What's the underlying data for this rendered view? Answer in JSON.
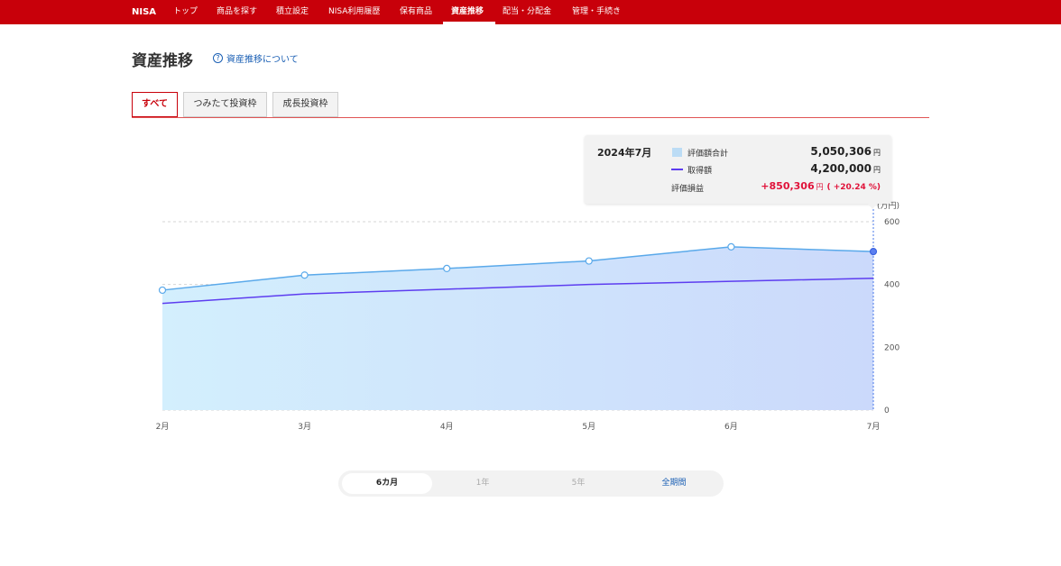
{
  "nav": {
    "brand": "NISA",
    "items": [
      {
        "label": "トップ"
      },
      {
        "label": "商品を探す"
      },
      {
        "label": "積立設定"
      },
      {
        "label": "NISA利用履歴"
      },
      {
        "label": "保有商品"
      },
      {
        "label": "資産推移",
        "active": true
      },
      {
        "label": "配当・分配金"
      },
      {
        "label": "管理・手続き"
      }
    ]
  },
  "page": {
    "title": "資産推移",
    "help_link": "資産推移について"
  },
  "tabs": [
    {
      "label": "すべて",
      "active": true
    },
    {
      "label": "つみたて投資枠"
    },
    {
      "label": "成長投資枠"
    }
  ],
  "tooltip": {
    "date": "2024年7月",
    "valuation_label": "評価額合計",
    "valuation_value": "5,050,306",
    "cost_label": "取得額",
    "cost_value": "4,200,000",
    "gain_label": "評価損益",
    "gain_value": "+850,306",
    "gain_pct": "( +20.24 %)",
    "unit": "円"
  },
  "colors": {
    "brand": "#c8000a",
    "valuation_line": "#5aa9ea",
    "cost_line": "#5d3df0",
    "gain": "#e0133a"
  },
  "chart_data": {
    "type": "area",
    "y_unit_label": "(万円)",
    "categories": [
      "2月",
      "3月",
      "4月",
      "5月",
      "6月",
      "7月"
    ],
    "ylim": [
      0,
      600
    ],
    "yticks": [
      "0",
      "200",
      "400",
      "600"
    ],
    "series": [
      {
        "name": "評価額合計",
        "kind": "area",
        "values": [
          382,
          430,
          451,
          475,
          520,
          505
        ]
      },
      {
        "name": "取得額",
        "kind": "line",
        "values": [
          340,
          370,
          385,
          400,
          410,
          420
        ]
      }
    ],
    "grid": true
  },
  "range_selector": [
    {
      "label": "6カ月",
      "active": true
    },
    {
      "label": "1年"
    },
    {
      "label": "5年"
    },
    {
      "label": "全期間",
      "link": true
    }
  ]
}
